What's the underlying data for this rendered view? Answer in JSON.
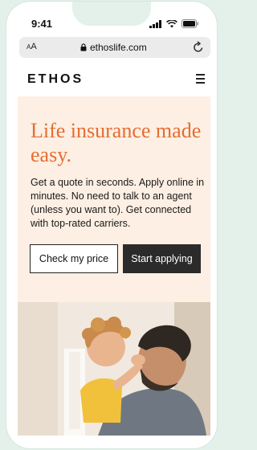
{
  "status_bar": {
    "time": "9:41"
  },
  "browser": {
    "text_size_label_small": "A",
    "text_size_label": "A",
    "url": "ethoslife.com"
  },
  "nav": {
    "logo": "ETHOS"
  },
  "hero": {
    "headline": "Life insurance made easy.",
    "body": "Get a quote in seconds. Apply online in minutes. No need to talk to an agent (unless you want to). Get connected with top-rated carriers.",
    "primary_button": "Check my price",
    "secondary_button": "Start applying"
  },
  "colors": {
    "accent": "#e56d33",
    "hero_bg": "#fdefe3",
    "dark_button": "#2b2b2b",
    "frame_bg": "#e3f1ea"
  },
  "icons": [
    "signal-icon",
    "wifi-icon",
    "battery-icon",
    "lock-icon",
    "reload-icon",
    "hamburger-menu-icon"
  ]
}
